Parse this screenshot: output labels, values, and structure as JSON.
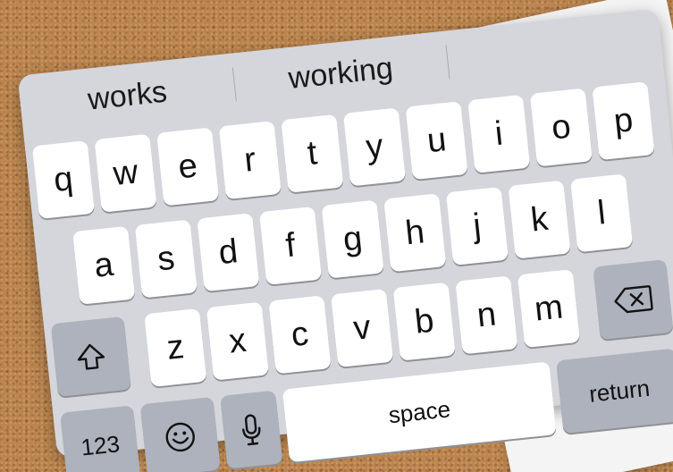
{
  "suggestions": [
    "works",
    "working",
    ""
  ],
  "rows": {
    "row1": [
      "q",
      "w",
      "e",
      "r",
      "t",
      "y",
      "u",
      "i",
      "o",
      "p"
    ],
    "row2": [
      "a",
      "s",
      "d",
      "f",
      "g",
      "h",
      "j",
      "k",
      "l"
    ],
    "row3": [
      "z",
      "x",
      "c",
      "v",
      "b",
      "n",
      "m"
    ]
  },
  "keys": {
    "numbers_label": "123",
    "space_label": "space",
    "return_label": "return"
  },
  "icons": {
    "shift": "shift-arrow-icon",
    "delete": "delete-backspace-icon",
    "emoji": "emoji-smiley-icon",
    "mic": "microphone-icon"
  }
}
